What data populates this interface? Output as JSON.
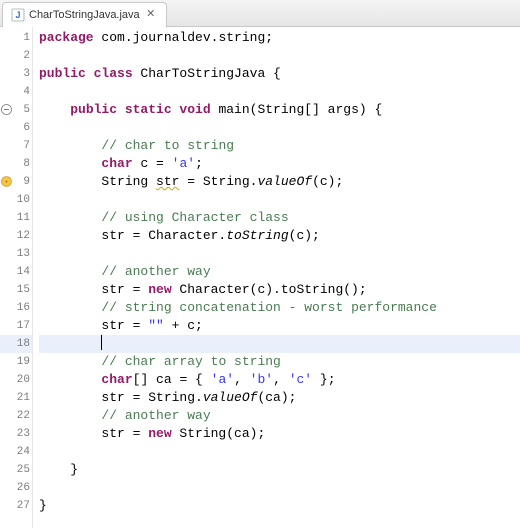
{
  "tab": {
    "filename": "CharToStringJava.java",
    "close_symbol": "✕"
  },
  "editor": {
    "current_line": 18,
    "lines": [
      {
        "n": 1,
        "ind": 0,
        "marker": null,
        "tokens": [
          {
            "t": "package ",
            "c": "kw"
          },
          {
            "t": "com.journaldev.string;",
            "c": ""
          }
        ]
      },
      {
        "n": 2,
        "ind": 0,
        "marker": null,
        "tokens": []
      },
      {
        "n": 3,
        "ind": 0,
        "marker": null,
        "tokens": [
          {
            "t": "public class ",
            "c": "kw"
          },
          {
            "t": "CharToStringJava {",
            "c": ""
          }
        ]
      },
      {
        "n": 4,
        "ind": 0,
        "marker": null,
        "tokens": []
      },
      {
        "n": 5,
        "ind": 1,
        "marker": "fold",
        "tokens": [
          {
            "t": "public static void ",
            "c": "kw"
          },
          {
            "t": "main(String[] args) {",
            "c": ""
          }
        ]
      },
      {
        "n": 6,
        "ind": 0,
        "marker": null,
        "tokens": []
      },
      {
        "n": 7,
        "ind": 2,
        "marker": null,
        "tokens": [
          {
            "t": "// char to string",
            "c": "com"
          }
        ]
      },
      {
        "n": 8,
        "ind": 2,
        "marker": null,
        "tokens": [
          {
            "t": "char",
            "c": "kw"
          },
          {
            "t": " c = ",
            "c": ""
          },
          {
            "t": "'a'",
            "c": "str"
          },
          {
            "t": ";",
            "c": ""
          }
        ]
      },
      {
        "n": 9,
        "ind": 2,
        "marker": "warn",
        "tokens": [
          {
            "t": "String ",
            "c": ""
          },
          {
            "t": "str",
            "c": "warn"
          },
          {
            "t": " = String.",
            "c": ""
          },
          {
            "t": "valueOf",
            "c": "sti"
          },
          {
            "t": "(c);",
            "c": ""
          }
        ]
      },
      {
        "n": 10,
        "ind": 0,
        "marker": null,
        "tokens": []
      },
      {
        "n": 11,
        "ind": 2,
        "marker": null,
        "tokens": [
          {
            "t": "// using Character class",
            "c": "com"
          }
        ]
      },
      {
        "n": 12,
        "ind": 2,
        "marker": null,
        "tokens": [
          {
            "t": "str = Character.",
            "c": ""
          },
          {
            "t": "toString",
            "c": "sti"
          },
          {
            "t": "(c);",
            "c": ""
          }
        ]
      },
      {
        "n": 13,
        "ind": 0,
        "marker": null,
        "tokens": []
      },
      {
        "n": 14,
        "ind": 2,
        "marker": null,
        "tokens": [
          {
            "t": "// another way",
            "c": "com"
          }
        ]
      },
      {
        "n": 15,
        "ind": 2,
        "marker": null,
        "tokens": [
          {
            "t": "str = ",
            "c": ""
          },
          {
            "t": "new",
            "c": "kw"
          },
          {
            "t": " Character(c).toString();",
            "c": ""
          }
        ]
      },
      {
        "n": 16,
        "ind": 2,
        "marker": null,
        "tokens": [
          {
            "t": "// string concatenation - worst performance",
            "c": "com"
          }
        ]
      },
      {
        "n": 17,
        "ind": 2,
        "marker": null,
        "tokens": [
          {
            "t": "str = ",
            "c": ""
          },
          {
            "t": "\"\"",
            "c": "str"
          },
          {
            "t": " + c;",
            "c": ""
          }
        ]
      },
      {
        "n": 18,
        "ind": 2,
        "marker": null,
        "tokens": []
      },
      {
        "n": 19,
        "ind": 2,
        "marker": null,
        "tokens": [
          {
            "t": "// char array to string",
            "c": "com"
          }
        ]
      },
      {
        "n": 20,
        "ind": 2,
        "marker": null,
        "tokens": [
          {
            "t": "char",
            "c": "kw"
          },
          {
            "t": "[] ca = { ",
            "c": ""
          },
          {
            "t": "'a'",
            "c": "str"
          },
          {
            "t": ", ",
            "c": ""
          },
          {
            "t": "'b'",
            "c": "str"
          },
          {
            "t": ", ",
            "c": ""
          },
          {
            "t": "'c'",
            "c": "str"
          },
          {
            "t": " };",
            "c": ""
          }
        ]
      },
      {
        "n": 21,
        "ind": 2,
        "marker": null,
        "tokens": [
          {
            "t": "str = String.",
            "c": ""
          },
          {
            "t": "valueOf",
            "c": "sti"
          },
          {
            "t": "(ca);",
            "c": ""
          }
        ]
      },
      {
        "n": 22,
        "ind": 2,
        "marker": null,
        "tokens": [
          {
            "t": "// another way",
            "c": "com"
          }
        ]
      },
      {
        "n": 23,
        "ind": 2,
        "marker": null,
        "tokens": [
          {
            "t": "str = ",
            "c": ""
          },
          {
            "t": "new",
            "c": "kw"
          },
          {
            "t": " String(ca);",
            "c": ""
          }
        ]
      },
      {
        "n": 24,
        "ind": 0,
        "marker": null,
        "tokens": []
      },
      {
        "n": 25,
        "ind": 1,
        "marker": null,
        "tokens": [
          {
            "t": "}",
            "c": ""
          }
        ]
      },
      {
        "n": 26,
        "ind": 0,
        "marker": null,
        "tokens": []
      },
      {
        "n": 27,
        "ind": 0,
        "marker": null,
        "tokens": [
          {
            "t": "}",
            "c": ""
          }
        ]
      }
    ],
    "indent_unit": "    "
  }
}
